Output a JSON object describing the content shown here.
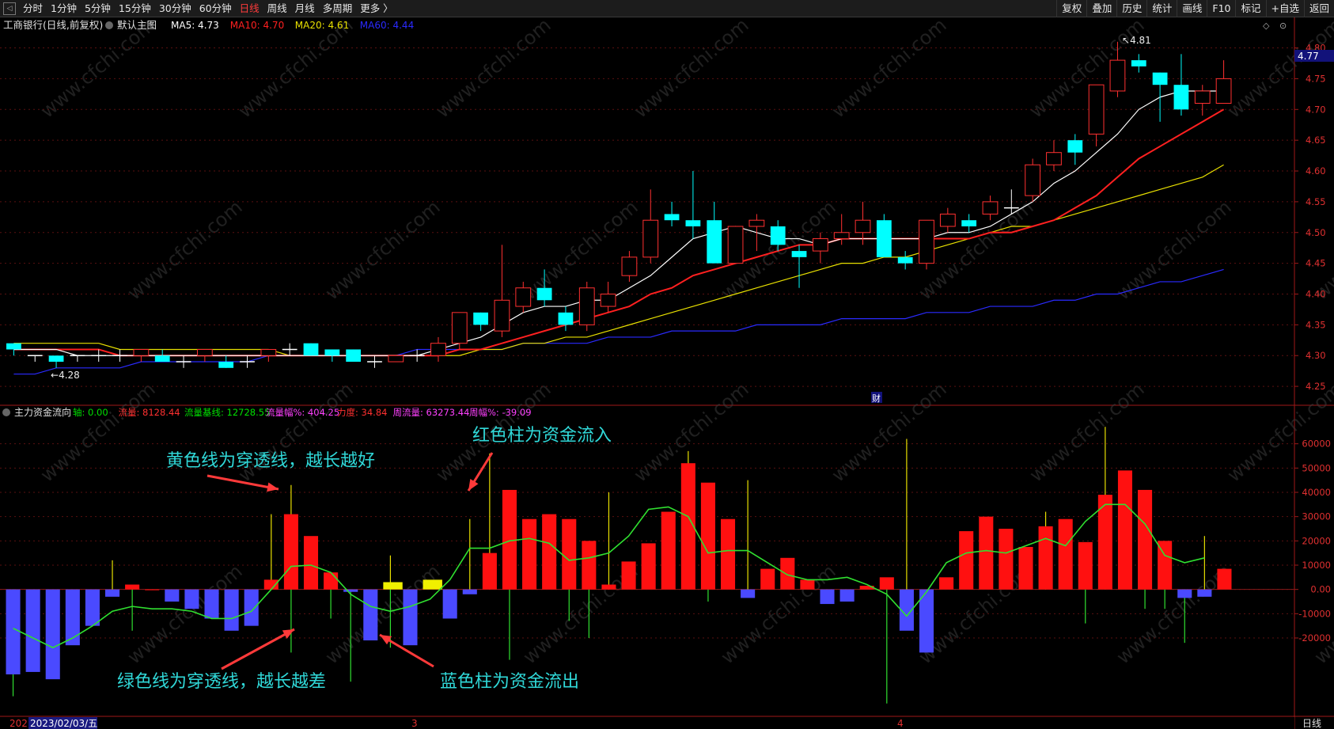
{
  "toolbar": {
    "periods": [
      "分时",
      "1分钟",
      "5分钟",
      "15分钟",
      "30分钟",
      "60分钟",
      "日线",
      "周线",
      "月线",
      "多周期",
      "更多 〉"
    ],
    "active_period": "日线",
    "right_buttons": [
      "复权",
      "叠加",
      "历史",
      "统计",
      "画线",
      "F10",
      "标记",
      "+自选",
      "返回"
    ]
  },
  "main_chart": {
    "title": "工商银行(日线,前复权)",
    "template": "默认主图",
    "ma": [
      {
        "label": "MA5: 4.73",
        "color": "#ffffff"
      },
      {
        "label": "MA10: 4.70",
        "color": "#ff2020"
      },
      {
        "label": "MA20: 4.61",
        "color": "#e8e000"
      },
      {
        "label": "MA60: 4.44",
        "color": "#2a2aff"
      }
    ],
    "price_axis": [
      "4.80",
      "4.75",
      "4.70",
      "4.65",
      "4.60",
      "4.55",
      "4.50",
      "4.45",
      "4.40",
      "4.35",
      "4.30",
      "4.25"
    ],
    "current_price": "4.77",
    "high_mark": "4.81",
    "low_mark": "4.28",
    "event_marker": "财"
  },
  "indicator": {
    "name": "主力资金流向",
    "values": [
      {
        "label": "轴: 0.00",
        "color": "#00e000"
      },
      {
        "label": "流量: 8128.44",
        "color": "#ff3030"
      },
      {
        "label": "流量基线: 12728.55",
        "color": "#00e000"
      },
      {
        "label": "流量幅%: 404.25",
        "color": "#ff40ff"
      },
      {
        "label": "力度: 34.84",
        "color": "#ff3030"
      },
      {
        "label": "周流量: 63273.44",
        "color": "#ff40ff"
      },
      {
        "label": "周幅%: -39.09",
        "color": "#ff40ff"
      }
    ],
    "axis": [
      "60000",
      "50000",
      "40000",
      "30000",
      "20000",
      "10000",
      "0.00",
      "-10000",
      "-20000"
    ]
  },
  "annotations": {
    "yellow_line": "黄色线为穿透线，越长越好",
    "red_bar": "红色柱为资金流入",
    "green_line": "绿色线为穿透线，越长越差",
    "blue_bar": "蓝色柱为资金流出"
  },
  "date_axis": {
    "start": "202",
    "selected_date": "2023/02/03/五",
    "month_3": "3",
    "month_4": "4",
    "period_label": "日线"
  },
  "colors": {
    "up": "#ff3030",
    "down": "#00ffff",
    "ma5": "#ffffff",
    "ma10": "#ff2020",
    "ma20": "#e8e000",
    "ma60": "#2a2aff",
    "inflow": "#ff1010",
    "outflow": "#4a4aff",
    "line_green": "#30e030",
    "line_yellow": "#e8e000",
    "annot": "#30d8d8"
  },
  "chart_data": {
    "type": "candlestick+bar",
    "candles": [
      [
        4.32,
        4.31,
        4.32,
        4.3
      ],
      [
        4.3,
        4.3,
        4.3,
        4.29
      ],
      [
        4.3,
        4.29,
        4.3,
        4.28
      ],
      [
        4.3,
        4.3,
        4.3,
        4.29
      ],
      [
        4.3,
        4.3,
        4.31,
        4.29
      ],
      [
        4.3,
        4.3,
        4.31,
        4.29
      ],
      [
        4.3,
        4.31,
        4.31,
        4.29
      ],
      [
        4.3,
        4.29,
        4.31,
        4.29
      ],
      [
        4.29,
        4.29,
        4.3,
        4.28
      ],
      [
        4.3,
        4.31,
        4.31,
        4.29
      ],
      [
        4.29,
        4.28,
        4.3,
        4.28
      ],
      [
        4.29,
        4.29,
        4.3,
        4.28
      ],
      [
        4.3,
        4.31,
        4.31,
        4.29
      ],
      [
        4.31,
        4.31,
        4.32,
        4.3
      ],
      [
        4.32,
        4.3,
        4.32,
        4.3
      ],
      [
        4.31,
        4.3,
        4.31,
        4.29
      ],
      [
        4.31,
        4.29,
        4.31,
        4.29
      ],
      [
        4.29,
        4.29,
        4.3,
        4.28
      ],
      [
        4.29,
        4.3,
        4.3,
        4.29
      ],
      [
        4.3,
        4.3,
        4.31,
        4.29
      ],
      [
        4.3,
        4.32,
        4.33,
        4.29
      ],
      [
        4.32,
        4.37,
        4.37,
        4.31
      ],
      [
        4.37,
        4.35,
        4.37,
        4.34
      ],
      [
        4.34,
        4.39,
        4.48,
        4.33
      ],
      [
        4.38,
        4.41,
        4.42,
        4.37
      ],
      [
        4.41,
        4.39,
        4.44,
        4.38
      ],
      [
        4.37,
        4.35,
        4.38,
        4.34
      ],
      [
        4.35,
        4.41,
        4.42,
        4.34
      ],
      [
        4.38,
        4.4,
        4.42,
        4.37
      ],
      [
        4.43,
        4.46,
        4.47,
        4.42
      ],
      [
        4.46,
        4.52,
        4.57,
        4.45
      ],
      [
        4.53,
        4.52,
        4.55,
        4.51
      ],
      [
        4.52,
        4.51,
        4.6,
        4.49
      ],
      [
        4.52,
        4.45,
        4.55,
        4.45
      ],
      [
        4.45,
        4.51,
        4.51,
        4.45
      ],
      [
        4.51,
        4.52,
        4.53,
        4.47
      ],
      [
        4.51,
        4.48,
        4.52,
        4.47
      ],
      [
        4.47,
        4.46,
        4.48,
        4.41
      ],
      [
        4.47,
        4.49,
        4.5,
        4.45
      ],
      [
        4.49,
        4.5,
        4.53,
        4.48
      ],
      [
        4.5,
        4.52,
        4.55,
        4.48
      ],
      [
        4.52,
        4.46,
        4.53,
        4.46
      ],
      [
        4.46,
        4.45,
        4.47,
        4.44
      ],
      [
        4.45,
        4.52,
        4.52,
        4.44
      ],
      [
        4.51,
        4.53,
        4.54,
        4.5
      ],
      [
        4.52,
        4.51,
        4.53,
        4.5
      ],
      [
        4.53,
        4.55,
        4.56,
        4.52
      ],
      [
        4.54,
        4.54,
        4.57,
        4.53
      ],
      [
        4.56,
        4.61,
        4.62,
        4.55
      ],
      [
        4.61,
        4.63,
        4.65,
        4.6
      ],
      [
        4.65,
        4.63,
        4.66,
        4.61
      ],
      [
        4.66,
        4.74,
        4.74,
        4.64
      ],
      [
        4.73,
        4.78,
        4.81,
        4.72
      ],
      [
        4.78,
        4.77,
        4.79,
        4.76
      ],
      [
        4.76,
        4.74,
        4.76,
        4.68
      ],
      [
        4.74,
        4.7,
        4.79,
        4.69
      ],
      [
        4.71,
        4.73,
        4.74,
        4.69
      ],
      [
        4.71,
        4.75,
        4.78,
        4.71
      ]
    ],
    "ma5": [
      4.31,
      4.31,
      4.31,
      4.3,
      4.3,
      4.3,
      4.3,
      4.3,
      4.3,
      4.3,
      4.3,
      4.3,
      4.3,
      4.3,
      4.3,
      4.3,
      4.3,
      4.3,
      4.3,
      4.3,
      4.31,
      4.32,
      4.33,
      4.35,
      4.37,
      4.38,
      4.38,
      4.39,
      4.39,
      4.41,
      4.43,
      4.46,
      4.49,
      4.5,
      4.51,
      4.5,
      4.49,
      4.49,
      4.48,
      4.49,
      4.49,
      4.49,
      4.49,
      4.49,
      4.5,
      4.5,
      4.51,
      4.53,
      4.55,
      4.58,
      4.6,
      4.63,
      4.66,
      4.7,
      4.72,
      4.73,
      4.73,
      4.73
    ],
    "ma10": [
      4.31,
      4.31,
      4.31,
      4.31,
      4.31,
      4.3,
      4.3,
      4.3,
      4.3,
      4.3,
      4.3,
      4.3,
      4.3,
      4.3,
      4.3,
      4.3,
      4.3,
      4.3,
      4.3,
      4.3,
      4.3,
      4.31,
      4.31,
      4.32,
      4.33,
      4.34,
      4.35,
      4.36,
      4.37,
      4.38,
      4.4,
      4.41,
      4.43,
      4.44,
      4.45,
      4.46,
      4.47,
      4.48,
      4.48,
      4.49,
      4.49,
      4.49,
      4.49,
      4.49,
      4.49,
      4.49,
      4.5,
      4.5,
      4.51,
      4.52,
      4.54,
      4.56,
      4.59,
      4.62,
      4.64,
      4.66,
      4.68,
      4.7
    ],
    "ma20": [
      4.32,
      4.32,
      4.32,
      4.32,
      4.32,
      4.31,
      4.31,
      4.31,
      4.31,
      4.31,
      4.31,
      4.31,
      4.31,
      4.3,
      4.3,
      4.3,
      4.3,
      4.3,
      4.3,
      4.3,
      4.3,
      4.3,
      4.31,
      4.31,
      4.32,
      4.32,
      4.33,
      4.33,
      4.34,
      4.35,
      4.36,
      4.37,
      4.38,
      4.39,
      4.4,
      4.41,
      4.42,
      4.43,
      4.44,
      4.45,
      4.45,
      4.46,
      4.46,
      4.47,
      4.48,
      4.49,
      4.5,
      4.51,
      4.51,
      4.52,
      4.53,
      4.54,
      4.55,
      4.56,
      4.57,
      4.58,
      4.59,
      4.61
    ],
    "ma60": [
      4.27,
      4.27,
      4.28,
      4.28,
      4.28,
      4.28,
      4.29,
      4.29,
      4.29,
      4.29,
      4.29,
      4.29,
      4.3,
      4.3,
      4.3,
      4.3,
      4.3,
      4.3,
      4.3,
      4.31,
      4.31,
      4.31,
      4.31,
      4.31,
      4.32,
      4.32,
      4.32,
      4.32,
      4.33,
      4.33,
      4.33,
      4.34,
      4.34,
      4.34,
      4.34,
      4.35,
      4.35,
      4.35,
      4.35,
      4.36,
      4.36,
      4.36,
      4.36,
      4.37,
      4.37,
      4.37,
      4.38,
      4.38,
      4.38,
      4.39,
      4.39,
      4.4,
      4.4,
      4.41,
      4.42,
      4.42,
      4.43,
      4.44
    ],
    "flow": [
      -35000,
      -34000,
      -37000,
      -23000,
      -15000,
      -3000,
      2000,
      0,
      -5000,
      -8000,
      -12000,
      -17000,
      -15000,
      4000,
      31000,
      22000,
      7000,
      -1000,
      -21000,
      3000,
      -23000,
      4000,
      -12000,
      -2000,
      15000,
      41000,
      29000,
      31000,
      29000,
      20000,
      2000,
      11500,
      19000,
      32000,
      52000,
      44000,
      29000,
      -3500,
      8500,
      13000,
      4000,
      -6000,
      -5000,
      1500,
      5000,
      -17000,
      -26000,
      5000,
      24000,
      30000,
      25000,
      17500,
      26000,
      29000,
      19500,
      39000,
      49000,
      41000,
      20000,
      -3500,
      -3000,
      8500
    ],
    "flow_colors_note": "yellow bars at indices 19 and 21 (small)",
    "baseline": [
      -16000,
      -20000,
      -24000,
      -20000,
      -15000,
      -9000,
      -7000,
      -8000,
      -8000,
      -9000,
      -12000,
      -12000,
      -9000,
      0,
      9500,
      10000,
      7000,
      -2000,
      -7000,
      -9000,
      -7000,
      -4000,
      4000,
      17000,
      17000,
      20000,
      21000,
      19000,
      12000,
      13000,
      15000,
      22000,
      33000,
      34000,
      30000,
      15000,
      16000,
      16000,
      11000,
      6000,
      4000,
      4000,
      5000,
      2000,
      -2000,
      -11000,
      -1000,
      11000,
      15000,
      16000,
      15000,
      18000,
      21000,
      18000,
      28000,
      35000,
      35000,
      27000,
      14000,
      11000,
      13000
    ],
    "wicks_pos": [
      0,
      0,
      0,
      0,
      0,
      12000,
      0,
      0,
      0,
      0,
      0,
      0,
      0,
      31000,
      43000,
      0,
      0,
      0,
      0,
      14000,
      0,
      0,
      0,
      29000,
      56000,
      0,
      0,
      0,
      0,
      0,
      40000,
      0,
      0,
      0,
      57000,
      0,
      0,
      45000,
      0,
      0,
      0,
      0,
      0,
      0,
      0,
      62000,
      0,
      0,
      0,
      0,
      0,
      0,
      32000,
      0,
      0,
      67000,
      0,
      0,
      0,
      0,
      22000
    ],
    "wicks_neg": [
      -44000,
      0,
      0,
      0,
      0,
      0,
      -17000,
      0,
      0,
      0,
      0,
      0,
      0,
      0,
      -26000,
      0,
      -12000,
      -38000,
      0,
      -24000,
      0,
      0,
      0,
      0,
      0,
      -29000,
      0,
      0,
      -13000,
      -20000,
      0,
      0,
      0,
      0,
      0,
      -5000,
      0,
      0,
      0,
      0,
      0,
      0,
      0,
      0,
      -47000,
      0,
      0,
      0,
      0,
      0,
      0,
      0,
      0,
      0,
      -14000,
      0,
      0,
      -8000,
      -8000,
      -22000,
      0
    ]
  }
}
